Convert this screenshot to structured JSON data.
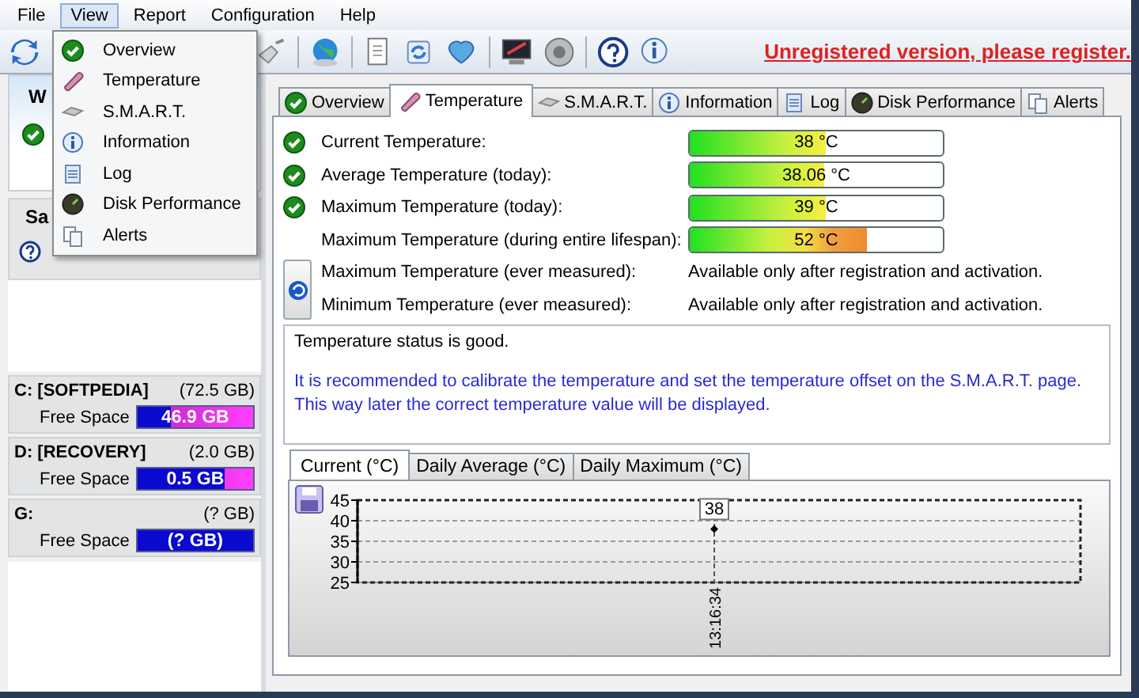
{
  "menu_bar": [
    {
      "label": "File",
      "selected": false
    },
    {
      "label": "View",
      "selected": true
    },
    {
      "label": "Report",
      "selected": false
    },
    {
      "label": "Configuration",
      "selected": false
    },
    {
      "label": "Help",
      "selected": false
    }
  ],
  "open_menu": {
    "items": [
      {
        "label": "Overview",
        "kind": "check"
      },
      {
        "label": "Temperature",
        "kind": "thermo"
      },
      {
        "label": "S.M.A.R.T.",
        "kind": "drive"
      },
      {
        "label": "Information",
        "kind": "info"
      },
      {
        "label": "Log",
        "kind": "doc"
      },
      {
        "label": "Disk Performance",
        "kind": "gauge"
      },
      {
        "label": "Alerts",
        "kind": "pages"
      }
    ]
  },
  "toolbar": {
    "notice": "Unregistered version, please register."
  },
  "sidebar": {
    "heading": "W",
    "section": "Sa",
    "drives": [
      {
        "name": "C: [SOFTPEDIA]",
        "size": "(72.5 GB)",
        "label": "Free Space",
        "free": "46.9 GB",
        "level": 0.29
      },
      {
        "name": "D: [RECOVERY]",
        "size": "(2.0 GB)",
        "label": "Free Space",
        "free": "0.5 GB",
        "level": 0.76
      },
      {
        "name": "G:",
        "size": "(? GB)",
        "label": "Free Space",
        "free": "(? GB)",
        "level": 1
      }
    ]
  },
  "tabs": [
    {
      "label": "Overview",
      "kind": "check",
      "selected": false
    },
    {
      "label": "Temperature",
      "kind": "thermo",
      "selected": true
    },
    {
      "label": "S.M.A.R.T.",
      "kind": "drive",
      "selected": false
    },
    {
      "label": "Information",
      "kind": "info",
      "selected": false
    },
    {
      "label": "Log",
      "kind": "doc",
      "selected": false
    },
    {
      "label": "Disk Performance",
      "kind": "gauge",
      "selected": false
    },
    {
      "label": "Alerts",
      "kind": "pages",
      "selected": false
    }
  ],
  "readings": [
    {
      "label": "Current Temperature:",
      "ok": true,
      "kind": "bar",
      "value": "38 °C",
      "level": 0.54,
      "hot": false
    },
    {
      "label": "Average Temperature (today):",
      "ok": true,
      "kind": "bar",
      "value": "38.06 °C",
      "level": 0.53,
      "hot": false
    },
    {
      "label": "Maximum Temperature (today):",
      "ok": true,
      "kind": "bar",
      "value": "39 °C",
      "level": 0.54,
      "hot": false
    },
    {
      "label": "Maximum Temperature (during entire lifespan):",
      "ok": false,
      "kind": "bar",
      "value": "52 °C",
      "level": 0.7,
      "hot": true
    },
    {
      "label": "Maximum Temperature (ever measured):",
      "ok": false,
      "kind": "text",
      "value": "Available only after registration and activation."
    },
    {
      "label": "Minimum Temperature (ever measured):",
      "ok": false,
      "kind": "text",
      "value": "Available only after registration and activation."
    }
  ],
  "status": {
    "summary": "Temperature status is good.",
    "advice": "It is recommended to calibrate the temperature and set the temperature offset on the S.M.A.R.T. page. This way later the correct temperature value will be displayed."
  },
  "chart_tabs": [
    {
      "label": "Current (°C)",
      "selected": true
    },
    {
      "label": "Daily Average (°C)",
      "selected": false
    },
    {
      "label": "Daily Maximum (°C)",
      "selected": false
    }
  ],
  "chart": {
    "chart_data": {
      "type": "line",
      "x": [
        "13:16:34"
      ],
      "series": [
        {
          "color": "#000000",
          "values": [
            38
          ],
          "marker": "diamond"
        }
      ],
      "ylim": [
        25,
        45
      ],
      "yticks": [
        25,
        30,
        35,
        40,
        45
      ],
      "grid": true,
      "ref_lines": [
        {
          "axis": "x",
          "value": "13:16:34"
        }
      ],
      "data_labels": true
    }
  }
}
